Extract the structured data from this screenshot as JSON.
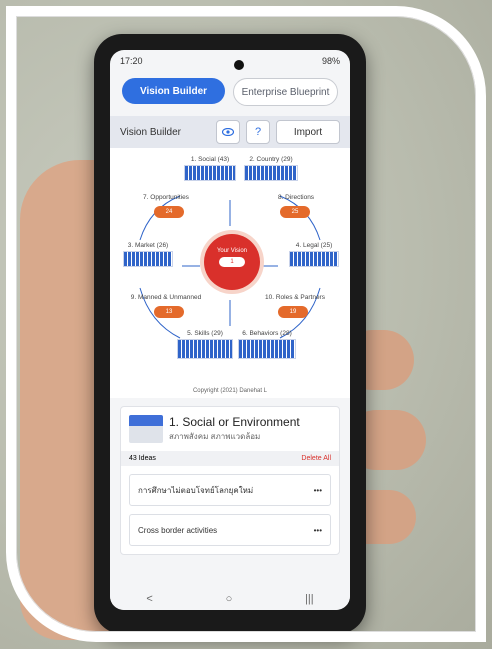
{
  "status": {
    "time": "17:20",
    "battery": "98%"
  },
  "tabs": {
    "active": "Vision Builder",
    "inactive": "Enterprise Blueprint"
  },
  "toolbar": {
    "title": "Vision Builder",
    "import_label": "Import",
    "eye_icon": "eye-icon",
    "help_icon": "help-icon"
  },
  "diagram": {
    "nodes": {
      "social": "1. Social (43)",
      "country": "2. Country (29)",
      "opportunities": "7. Opportunities",
      "directions": "8. Directions",
      "market": "3. Market (26)",
      "legal": "4. Legal (25)",
      "manned": "9. Manned & Unmanned",
      "roles": "10. Roles & Partners",
      "skills": "5. Skills (29)",
      "behaviors": "6. Behaviors (28)"
    },
    "badges": {
      "opportunities": "24",
      "directions": "25",
      "manned": "13",
      "roles": "19"
    },
    "center": {
      "label": "Your Vision",
      "count": "1"
    },
    "copyright": "Copyright (2021) Danehat L"
  },
  "card": {
    "title": "1. Social or Environment",
    "subtitle": "สภาพสังคม สภาพแวดล้อม",
    "ideas": "43 Ideas",
    "delete_label": "Delete All",
    "items": [
      {
        "text": "การศึกษาไม่ตอบโจทย์โลกยุคใหม่",
        "more": "•••"
      },
      {
        "text": "Cross border activities",
        "more": "•••"
      }
    ]
  },
  "nav": {
    "back": "<",
    "home": "○",
    "recent": "|||"
  },
  "colors": {
    "accent": "#2f6fe0",
    "vision": "#d9302b",
    "badge": "#e46a2b"
  }
}
